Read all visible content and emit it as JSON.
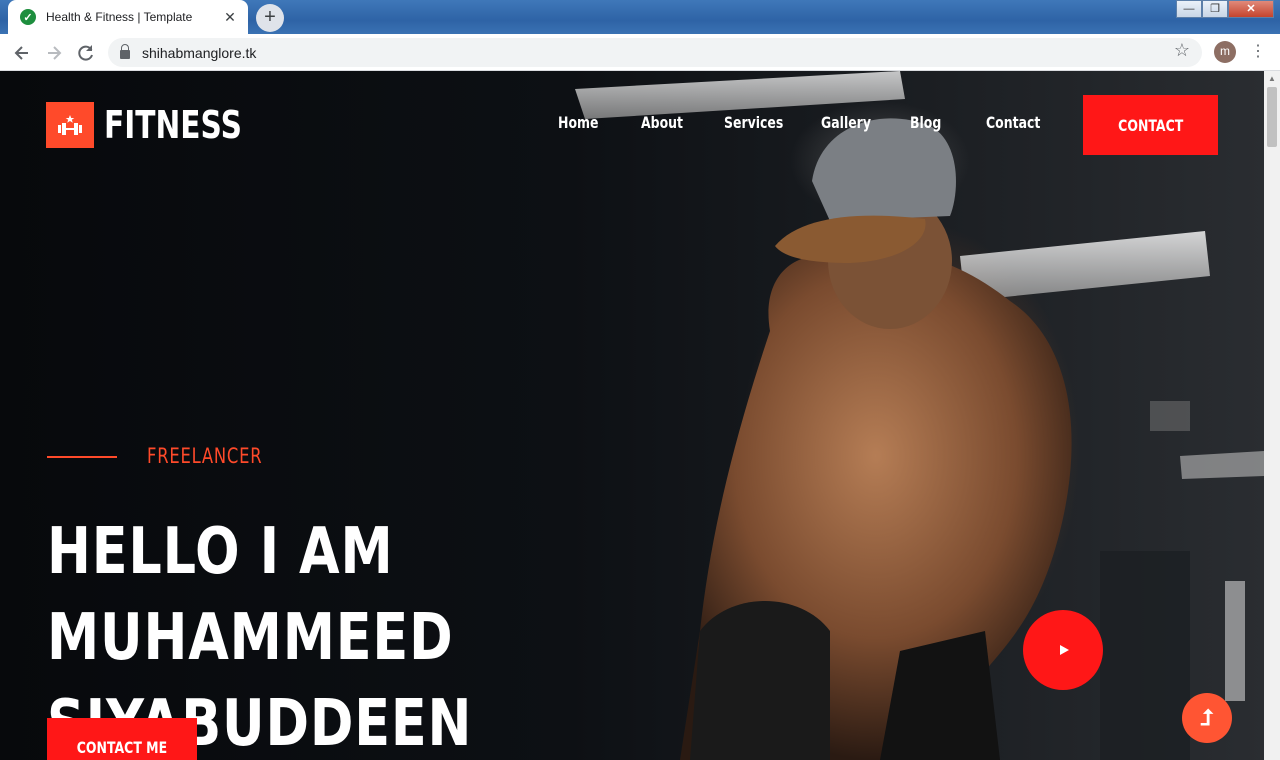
{
  "browser": {
    "tab_title": "Health & Fitness | Template",
    "tab_close": "✕",
    "new_tab": "+",
    "url": "shihabmanglore.tk",
    "profile_initial": "m",
    "window_min": "—",
    "window_max": "❐",
    "window_close": "✕"
  },
  "site": {
    "logo_text": "FITNESS",
    "nav": [
      "Home",
      "About",
      "Services",
      "Gallery",
      "Blog",
      "Contact"
    ],
    "header_button": "CONTACT"
  },
  "hero": {
    "eyebrow": "FREELANCER",
    "title_line1": "HELLO I AM MUHAMMEED",
    "title_line2": "SIYABUDDEEN",
    "cta": "CONTACT ME"
  },
  "colors": {
    "accent": "#ff1717",
    "logo_accent": "#ff4a2a"
  },
  "icons": {
    "tab_favicon": "check-circle-icon",
    "logo": "dumbbell-icon",
    "play": "play-icon",
    "back_to_top": "arrow-up-icon"
  }
}
